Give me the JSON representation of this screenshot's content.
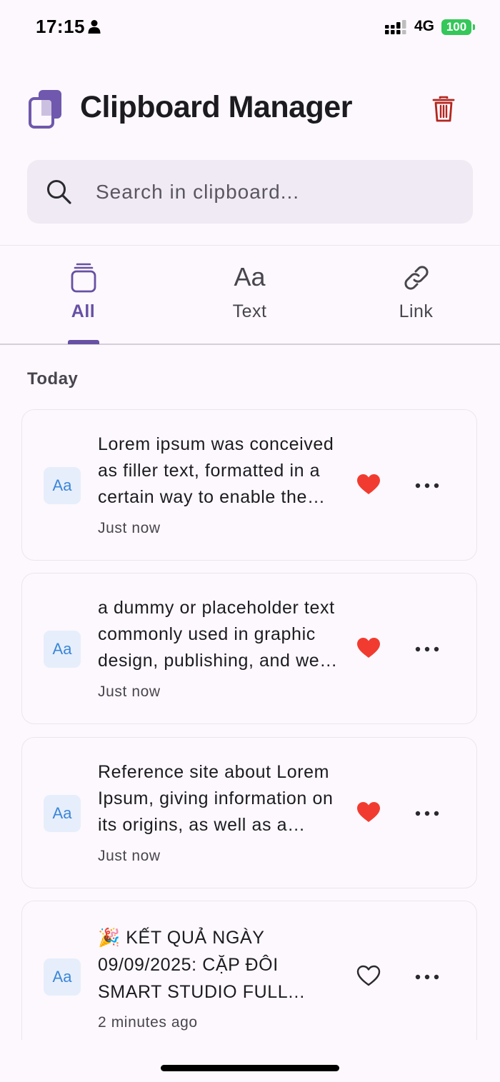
{
  "status_bar": {
    "time": "17:15",
    "network": "4G",
    "battery": "100"
  },
  "header": {
    "title": "Clipboard Manager"
  },
  "search": {
    "placeholder": "Search in clipboard...",
    "value": ""
  },
  "tabs": [
    {
      "label": "All",
      "icon": "stack-icon",
      "active": true
    },
    {
      "label": "Text",
      "icon": "text-type-icon",
      "glyph": "Aa",
      "active": false
    },
    {
      "label": "Link",
      "icon": "link-icon",
      "active": false
    }
  ],
  "section": {
    "title": "Today"
  },
  "clips": [
    {
      "type_label": "Aa",
      "text": "Lorem ipsum was conceived as filler text, formatted in a certain way to enable the presentation of graphic elements",
      "time": "Just now",
      "favorite": true
    },
    {
      "type_label": "Aa",
      "text": "a dummy or placeholder text commonly used in graphic design, publishing, and web development",
      "time": "Just now",
      "favorite": true
    },
    {
      "type_label": "Aa",
      "text": "Reference site about Lorem Ipsum, giving information on its origins, as well as a random Lipsum generator",
      "time": "Just now",
      "favorite": true
    },
    {
      "type_label": "Aa",
      "text": "🎉 KẾT QUẢ NGÀY 09/09/2025: CẶP ĐÔI SMART STUDIO FULL NHẤT",
      "time": "2 minutes ago",
      "favorite": false
    }
  ],
  "colors": {
    "accent": "#6750a4",
    "danger": "#b3261e",
    "favorite": "#f23b30",
    "badge_bg": "#e6eefb",
    "badge_text": "#3b86d8"
  }
}
